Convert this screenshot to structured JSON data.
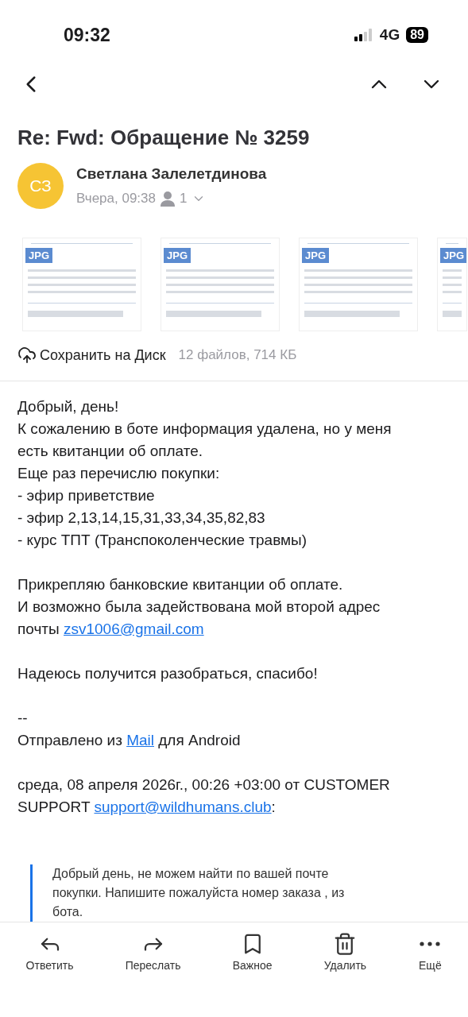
{
  "status_bar": {
    "time": "09:32",
    "network": "4G",
    "battery": "89"
  },
  "subject": "Re: Fwd: Обращение № 3259",
  "sender": {
    "initials": "СЗ",
    "name": "Светлана Залелетдинова",
    "date": "Вчера, 09:38",
    "recipients": "1"
  },
  "attachments": [
    {
      "type": "JPG"
    },
    {
      "type": "JPG"
    },
    {
      "type": "JPG"
    },
    {
      "type": "JPG"
    }
  ],
  "save_label": "Сохранить на Диск",
  "files_info": "12 файлов, 714 КБ",
  "body": [
    {
      "lines": [
        [
          {
            "text": "Добрый, день!"
          }
        ],
        [
          {
            "text": "К сожалению в боте информация удалена, но у меня"
          }
        ],
        [
          {
            "text": "есть квитанции об оплате."
          }
        ],
        [
          {
            "text": "Еще раз перечислю покупки:"
          }
        ],
        [
          {
            "text": "- эфир приветствие"
          }
        ],
        [
          {
            "text": "- эфир 2,13,14,15,31,33,34,35,82,83"
          }
        ],
        [
          {
            "text": "- курс ТПТ (Транспоколенческие травмы)"
          }
        ]
      ]
    },
    {
      "lines": [
        [
          {
            "text": "Прикрепляю банковские квитанции об оплате."
          }
        ],
        [
          {
            "text": "И возможно была задействована мой второй адрес"
          }
        ],
        [
          {
            "text": "почты "
          },
          {
            "text": "zsv1006@gmail.com",
            "link": true
          }
        ]
      ]
    },
    {
      "lines": [
        [
          {
            "text": "Надеюсь получится разобраться, спасибо!"
          }
        ]
      ]
    },
    {
      "lines": [
        [
          {
            "text": "--"
          }
        ],
        [
          {
            "text": "Отправлено из "
          },
          {
            "text": "Mail",
            "link": true
          },
          {
            "text": " для Android"
          }
        ]
      ]
    },
    {
      "lines": [
        [
          {
            "text": "среда, 08 апреля 2026г., 00:26 +03:00 от CUSTOMER"
          }
        ],
        [
          {
            "text": "SUPPORT "
          },
          {
            "text": "support@wildhumans.club",
            "link": true
          },
          {
            "text": ":"
          }
        ]
      ]
    }
  ],
  "quote": {
    "lines": [
      "Добрый день, не можем найти по вашей почте",
      "покупки. Напишите пожалуйста номер заказа , из",
      "бота."
    ]
  },
  "toolbar": [
    {
      "kind": "reply",
      "label": "Ответить"
    },
    {
      "kind": "forward",
      "label": "Переслать"
    },
    {
      "kind": "bookmark",
      "label": "Важное"
    },
    {
      "kind": "delete",
      "label": "Удалить"
    },
    {
      "kind": "more",
      "label": "Ещё"
    }
  ]
}
